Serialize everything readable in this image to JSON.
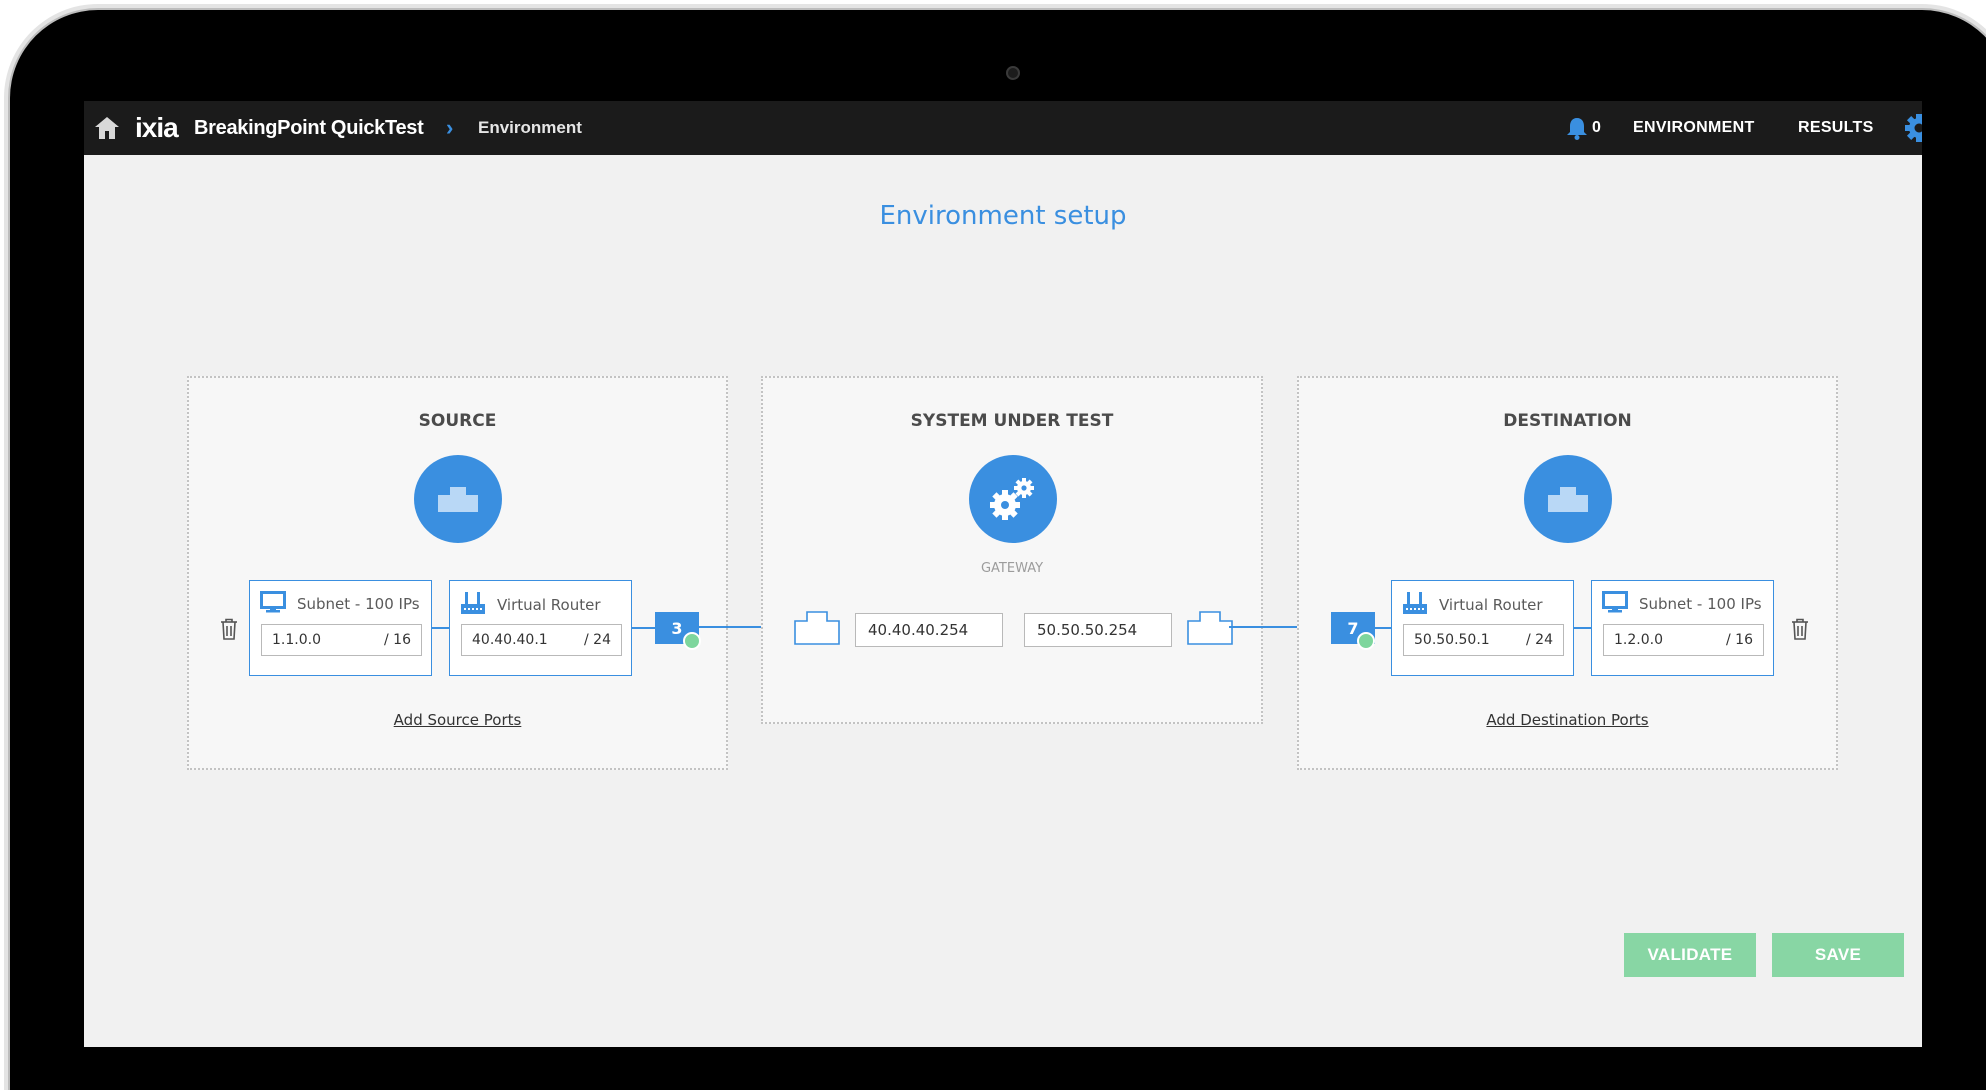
{
  "topbar": {
    "brand": "ixia",
    "product": "BreakingPoint QuickTest",
    "breadcrumb_sep": "›",
    "breadcrumb": "Environment",
    "notifications": "0",
    "nav": [
      "ENVIRONMENT",
      "RESULTS"
    ]
  },
  "page": {
    "title": "Environment setup"
  },
  "source": {
    "title": "SOURCE",
    "subnet_label": "Subnet - 100 IPs",
    "subnet_ip": "1.1.0.0",
    "subnet_mask": "/ 16",
    "router_label": "Virtual Router",
    "router_ip": "40.40.40.1",
    "router_mask": "/ 24",
    "port": "3",
    "add_link": "Add Source Ports"
  },
  "sut": {
    "title": "SYSTEM UNDER TEST",
    "type": "GATEWAY",
    "left_ip": "40.40.40.254",
    "right_ip": "50.50.50.254"
  },
  "destination": {
    "title": "DESTINATION",
    "router_label": "Virtual Router",
    "router_ip": "50.50.50.1",
    "router_mask": "/ 24",
    "subnet_label": "Subnet - 100 IPs",
    "subnet_ip": "1.2.0.0",
    "subnet_mask": "/ 16",
    "port": "7",
    "add_link": "Add Destination Ports"
  },
  "actions": {
    "validate": "VALIDATE",
    "save": "SAVE"
  },
  "colors": {
    "accent": "#3a8fe0",
    "topbar": "#1b1b1b",
    "button": "#88d6a4",
    "port_status": "#7ed69d"
  }
}
